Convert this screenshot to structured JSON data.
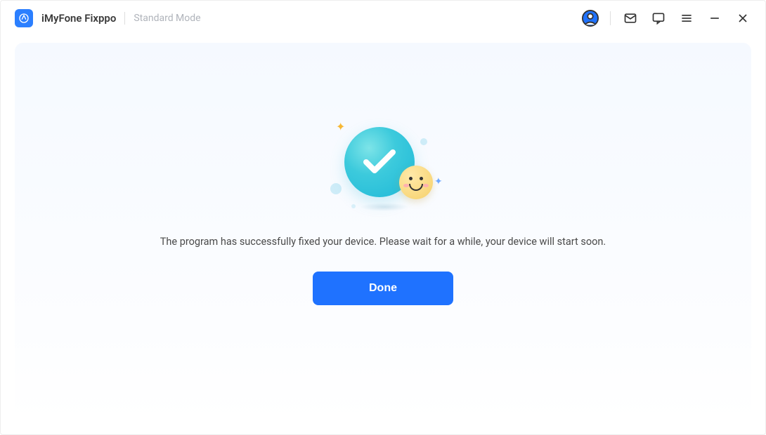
{
  "header": {
    "app_name": "iMyFone Fixppo",
    "mode": "Standard Mode"
  },
  "titlebar_icons": {
    "account": "account-icon",
    "mail": "mail-icon",
    "feedback": "feedback-icon",
    "menu": "menu-icon",
    "minimize": "minimize-icon",
    "close": "close-icon"
  },
  "main": {
    "status_icon": "success-check",
    "message": "The program has successfully fixed your device. Please wait for a while, your device will start soon.",
    "done_label": "Done"
  },
  "colors": {
    "accent": "#1f72ff",
    "muted": "#b0b4bb",
    "text": "#4a4a4a"
  }
}
